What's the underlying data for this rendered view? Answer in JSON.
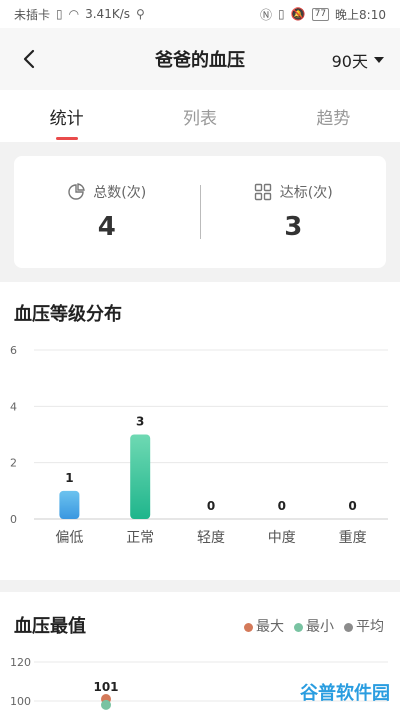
{
  "statusbar": {
    "carrier": "未插卡",
    "speed": "3.41K/s",
    "battery": "77",
    "time": "晚上8:10"
  },
  "header": {
    "title": "爸爸的血压",
    "range_label": "90天"
  },
  "tabs": [
    {
      "label": "统计",
      "active": true
    },
    {
      "label": "列表",
      "active": false
    },
    {
      "label": "趋势",
      "active": false
    }
  ],
  "summary": {
    "total_label": "总数(次)",
    "total_value": "4",
    "met_label": "达标(次)",
    "met_value": "3"
  },
  "distribution": {
    "title": "血压等级分布"
  },
  "extremes": {
    "title": "血压最值",
    "legend": [
      {
        "label": "最大",
        "color": "#d47a5a"
      },
      {
        "label": "最小",
        "color": "#79c3a2"
      },
      {
        "label": "平均",
        "color": "#8c8c8c"
      }
    ]
  },
  "chart_data": [
    {
      "type": "bar",
      "title": "血压等级分布",
      "categories": [
        "偏低",
        "正常",
        "轻度",
        "中度",
        "重度"
      ],
      "values": [
        1,
        3,
        0,
        0,
        0
      ],
      "ylim": [
        0,
        6
      ],
      "yticks": [
        0,
        2,
        4,
        6
      ],
      "grid": true,
      "colors": [
        "#3a97e0",
        "#1fb58c",
        "#999999",
        "#999999",
        "#999999"
      ]
    },
    {
      "type": "scatter",
      "title": "血压最值",
      "yticks": [
        100,
        120
      ],
      "points": [
        {
          "series": "最大",
          "value": 101
        },
        {
          "series": "最小",
          "value": 98
        }
      ],
      "grid": true
    }
  ],
  "watermark": {
    "text": "谷普软件园"
  }
}
